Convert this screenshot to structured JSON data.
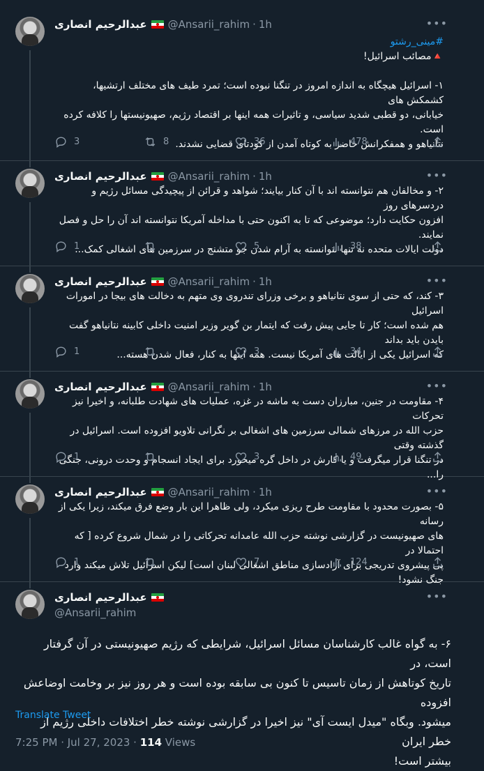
{
  "author": {
    "name": "عبدالرحیم انصاری",
    "handle": "@Ansarii_rahim",
    "time": "1h"
  },
  "tweets": [
    {
      "lines": [
        "#مینی_رشتو",
        "🔺مصائب اسرائیل!",
        "",
        "۱- اسرائیل هیچگاه به اندازه امروز در تنگنا نبوده است؛ تمرد طیف های مختلف ارتشیها، کشمکش های",
        "خیابانی، دو قطبی شدید سیاسی، و تاثیرات همه اینها بر اقتصاد رژیم، صهیونیستها را کلافه کرده است.",
        "نتانیاهو و همفکرانش حاضر به کوتاه آمدن از کودتای قضایی نشدند."
      ],
      "replies": "3",
      "retweets": "8",
      "likes": "36",
      "views": "478"
    },
    {
      "lines": [
        "۲- و مخالفان هم نتوانسته اند با آن کنار بیایند؛ شواهد و قرائن از پیچیدگی مسائل رژیم و دردسرهای روز",
        "افزون حکایت دارد؛ موضوعی که تا به اکنون حتی با مداخله آمریکا نتوانسته اند آن را حل و فصل نمایند.",
        "دولت ایالات متحده نه تنها نتوانسته به آرام شدن جو متشنج در سرزمین های اشغالی کمک..."
      ],
      "replies": "1",
      "retweets": "",
      "likes": "5",
      "views": "38"
    },
    {
      "lines": [
        "۳- کند، که حتی از سوی نتانیاهو و برخی وزرای تندروی وی متهم به دخالت های بیجا در امورات اسرائیل",
        "هم شده است؛ کار تا جایی پیش رفت که ایتمار بن گویر وزیر امنیت داخلی کابینه نتانیاهو گفت بایدن باید بداند",
        "که اسرائیل یکی از ایالت های آمریکا نیست. همه اینها به کنار، فعال شدن هسته..."
      ],
      "replies": "1",
      "retweets": "",
      "likes": "3",
      "views": "34"
    },
    {
      "lines": [
        "۴- مقاومت در جنین، مبارزان دست به ماشه در غزه، عملیات های شهادت طلبانه، و اخیرا نیز تحرکات",
        "حزب الله در مرزهای شمالی سرزمین های اشغالی بر نگرانی تلاویو افزوده است. اسرائیل در گذشته وقتی",
        "در تنگنا قرار میگرفت و یا کارش در داخل گره میخورد برای ایجاد انسجام و وحدت درونی، جنگی را..."
      ],
      "replies": "1",
      "retweets": "",
      "likes": "3",
      "views": "49"
    },
    {
      "lines": [
        "۵- بصورت محدود با مقاومت طرح ریزی میکرد، ولی ظاهرا این بار وضع فرق میکند، زیرا یکی از رسانه",
        "های صهیونیست در گزارشی نوشته حزب الله عامدانه تحرکاتی را در شمال شروع کرده [ که احتمالا در",
        "پی پیشروی تدریجی برای آزادسازی مناطق اشغالی لبنان است] لیکن اسرائیل تلاش میکند وارد جنگ نشود!"
      ],
      "replies": "1",
      "retweets": "",
      "likes": "7",
      "views": "124"
    }
  ],
  "main_tweet": {
    "lines": [
      "۶- به گواه غالب کارشناسان مسائل اسرائیل، شرایطی که رژیم صهیونیستی در آن گرفتار است، در",
      "تاریخ کوتاهش از زمان تاسیس تا کنون بی سابقه بوده است و هر روز نیز بر وخامت اوضاعش افزوده",
      "میشود. وبگاه \"میدل ایست آی\" نیز اخیرا در گزارشی نوشته خطر اختلافات داخلی رژیم از خطر ایران",
      "بیشتر است!"
    ],
    "translate_label": "Translate Tweet",
    "timestamp": "7:25 PM · Jul 27, 2023 · ",
    "views_count": "114",
    "views_label": " Views"
  },
  "colors": {
    "background": "#15202b",
    "accent": "#1d9bf0",
    "muted": "#8b98a5",
    "border": "#38444d"
  }
}
